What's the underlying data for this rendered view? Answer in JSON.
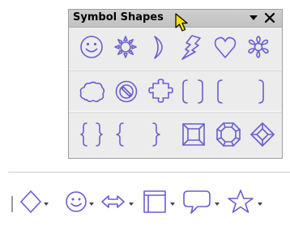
{
  "panel": {
    "title": "Symbol Shapes",
    "menu_icon": "triangle-down-icon",
    "close_icon": "close-icon",
    "rows": [
      [
        "smiley-icon",
        "sun-icon",
        "moon-icon",
        "lightning-icon",
        "heart-icon",
        "flower-icon"
      ],
      [
        "cloud-icon",
        "prohibited-icon",
        "puzzle-icon",
        "double-bracket-icon",
        "left-bracket-icon",
        "right-bracket-icon"
      ],
      [
        "double-brace-icon",
        "left-brace-icon",
        "right-brace-icon",
        "square-bevel-icon",
        "octagon-bevel-icon",
        "diamond-bevel-icon"
      ]
    ]
  },
  "toolbar": {
    "items": [
      {
        "icon": "diamond-icon",
        "dropdown": true
      },
      {
        "icon": "smiley-icon",
        "dropdown": true
      },
      {
        "icon": "left-right-arrow-icon",
        "dropdown": true
      },
      {
        "icon": "flowchart-process-icon",
        "dropdown": true
      },
      {
        "icon": "callout-icon",
        "dropdown": true
      },
      {
        "icon": "star-icon",
        "dropdown": true
      }
    ]
  },
  "colors": {
    "shape_stroke": "#6a5ed0",
    "panel_bg": "#ececec",
    "title_bar": "#c8c8c8",
    "cursor_fill": "#f5e000"
  }
}
